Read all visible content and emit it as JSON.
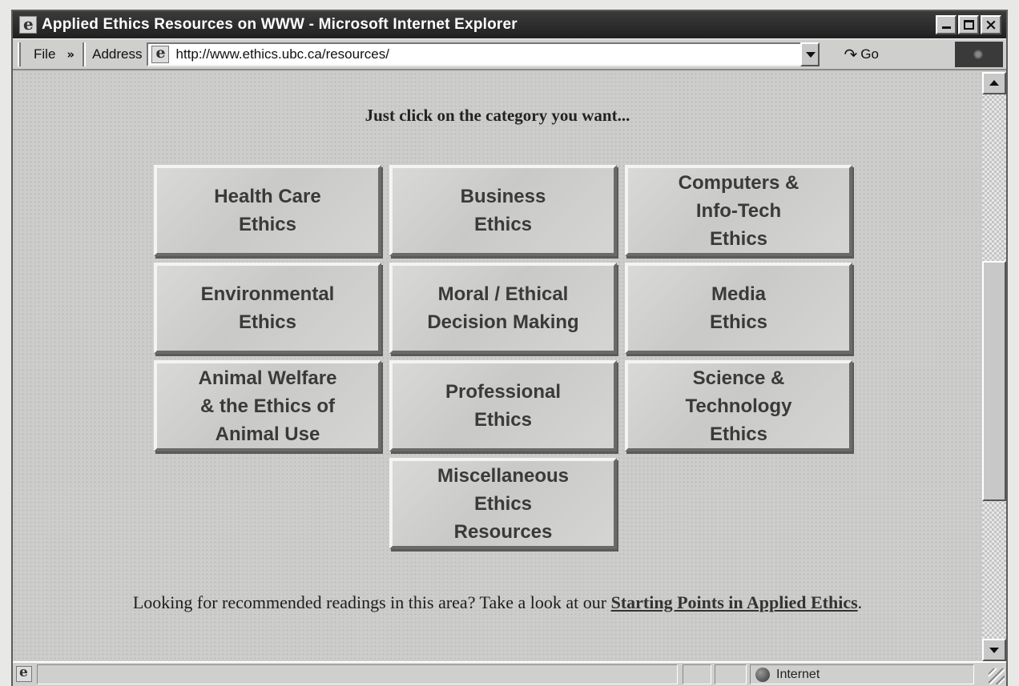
{
  "window": {
    "title": "Applied Ethics Resources on WWW - Microsoft Internet Explorer"
  },
  "toolbar": {
    "file_menu": "File",
    "chevron": "»",
    "address_label": "Address",
    "url": "http://www.ethics.ubc.ca/resources/",
    "go_label": "Go"
  },
  "page": {
    "headline": "Just click on the category you want...",
    "categories": [
      {
        "label": "Health Care\nEthics"
      },
      {
        "label": "Business\nEthics"
      },
      {
        "label": "Computers &\nInfo-Tech\nEthics"
      },
      {
        "label": "Environmental\nEthics"
      },
      {
        "label": "Moral / Ethical\nDecision Making"
      },
      {
        "label": "Media\nEthics"
      },
      {
        "label": "Animal Welfare\n& the Ethics of\nAnimal Use"
      },
      {
        "label": "Professional\nEthics"
      },
      {
        "label": "Science &\nTechnology\nEthics"
      },
      {
        "label": "Miscellaneous\nEthics\nResources"
      }
    ],
    "footer_text": "Looking for recommended readings in this area? Take a look at our ",
    "footer_link": "Starting Points in Applied Ethics",
    "footer_end": "."
  },
  "statusbar": {
    "zone": "Internet"
  }
}
